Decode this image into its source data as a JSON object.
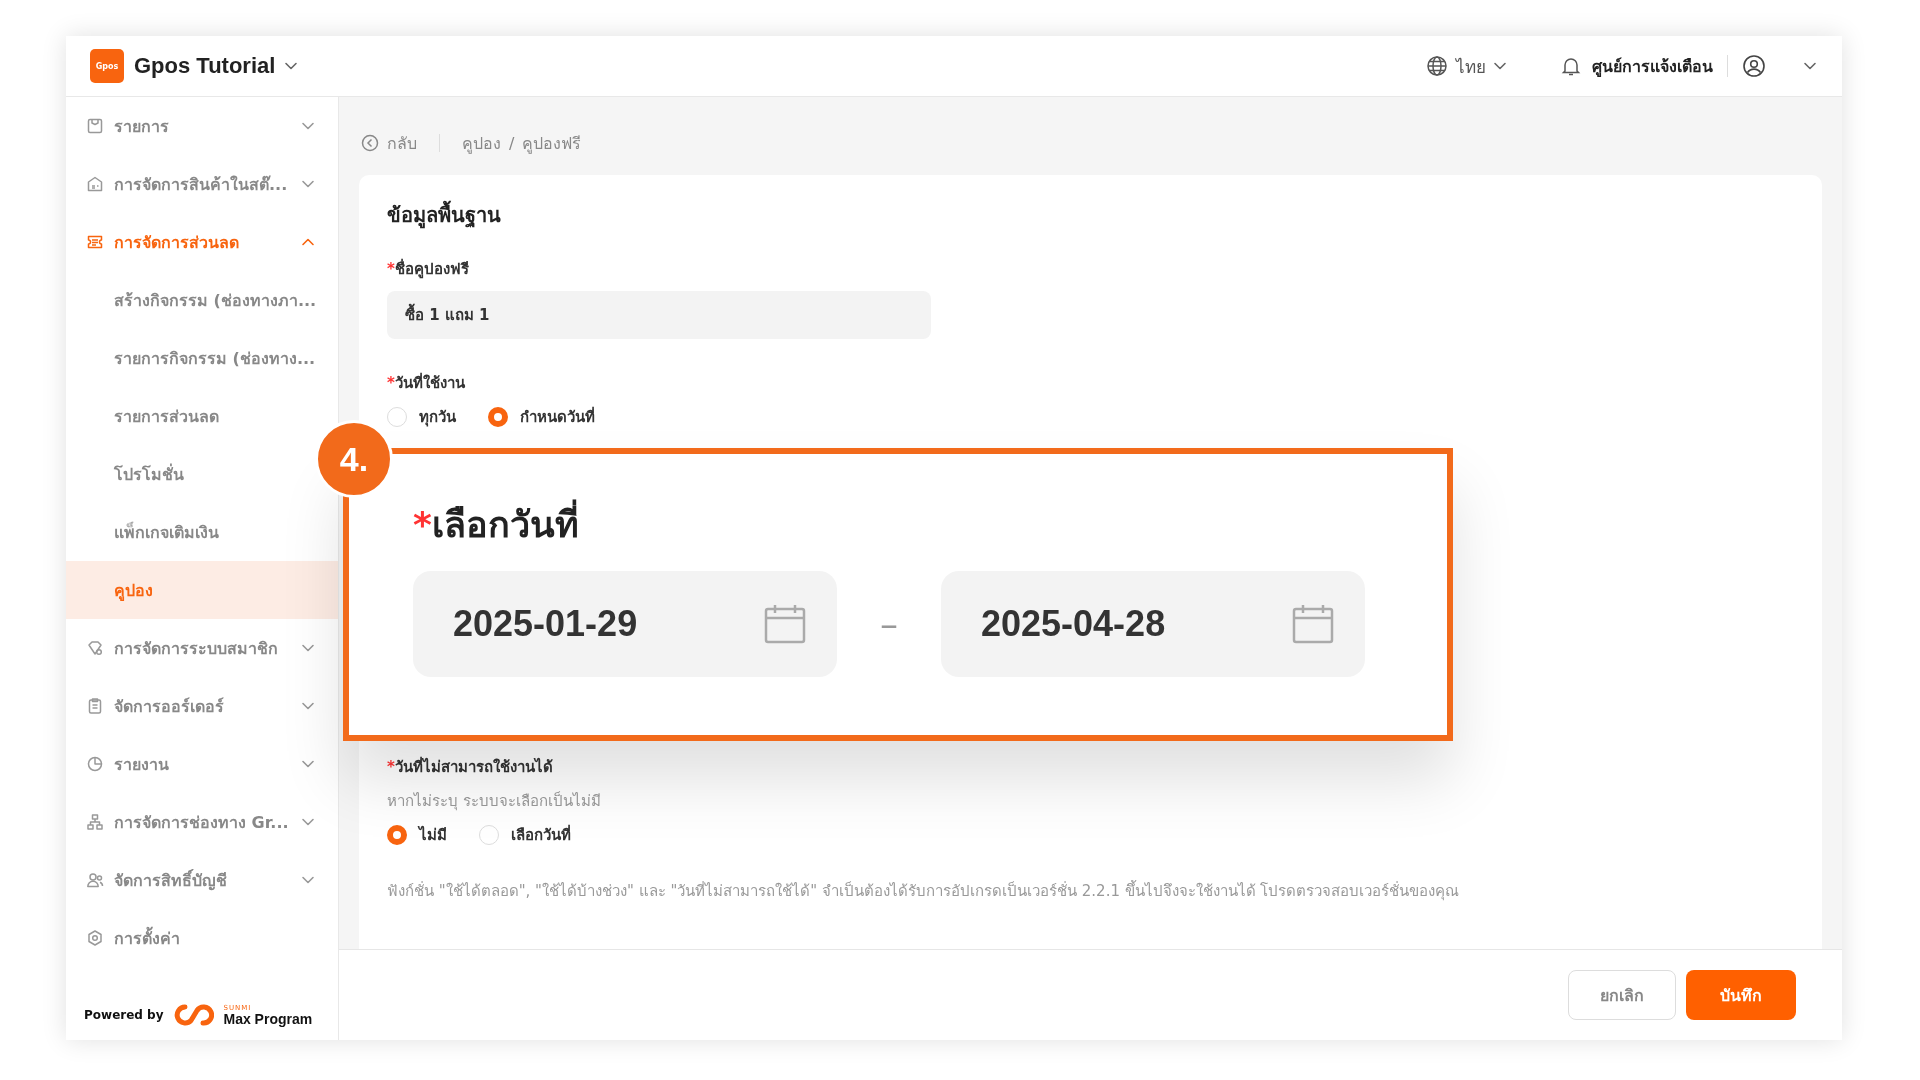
{
  "header": {
    "logo_text": "Gpos",
    "title": "Gpos Tutorial",
    "language": "ไทย",
    "notifications": "ศูนย์การแจ้งเตือน"
  },
  "sidebar": {
    "items": [
      {
        "label": "รายการ",
        "expanded": false
      },
      {
        "label": "การจัดการสินค้าในสต๊...",
        "expanded": false
      },
      {
        "label": "การจัดการส่วนลด",
        "expanded": true,
        "children": [
          {
            "label": "สร้างกิจกรรม (ช่องทางภา...",
            "selected": false
          },
          {
            "label": "รายการกิจกรรม (ช่องทาง...",
            "selected": false
          },
          {
            "label": "รายการส่วนลด",
            "selected": false
          },
          {
            "label": "โปรโมชั่น",
            "selected": false
          },
          {
            "label": "แพ็กเกจเติมเงิน",
            "selected": false
          },
          {
            "label": "คูปอง",
            "selected": true
          }
        ]
      },
      {
        "label": "การจัดการระบบสมาชิก",
        "expanded": false
      },
      {
        "label": "จัดการออร์เดอร์",
        "expanded": false
      },
      {
        "label": "รายงาน",
        "expanded": false
      },
      {
        "label": "การจัดการช่องทาง Gr...",
        "expanded": false
      },
      {
        "label": "จัดการสิทธิ์บัญชี",
        "expanded": false
      },
      {
        "label": "การตั้งค่า"
      }
    ],
    "footer": {
      "powered_by": "Powered by",
      "brand_small": "SUNMI",
      "brand": "Max Program"
    }
  },
  "breadcrumb": {
    "back": "กลับ",
    "separator": "/",
    "path": [
      "คูปอง",
      "คูปองฟรี"
    ]
  },
  "form": {
    "section_title": "ข้อมูลพื้นฐาน",
    "coupon_name": {
      "label": "ชื่อคูปองฟรี",
      "required_mark": "*",
      "value": "ซื้อ 1 แถม 1"
    },
    "usage_date": {
      "label": "วันที่ใช้งาน",
      "required_mark": "*",
      "options": [
        {
          "label": "ทุกวัน",
          "selected": false
        },
        {
          "label": "กำหนดวันที่",
          "selected": true
        }
      ]
    },
    "unavailable_date": {
      "label": "วันที่ไม่สามารถใช้งานได้",
      "required_mark": "*",
      "hint": "หากไม่ระบุ ระบบจะเลือกเป็นไม่มี",
      "options": [
        {
          "label": "ไม่มี",
          "selected": true
        },
        {
          "label": "เลือกวันที่",
          "selected": false
        }
      ]
    },
    "note": "ฟังก์ชั่น \"ใช้ได้ตลอด\", \"ใช้ได้บ้างช่วง\" และ \"วันที่ไม่สามารถใช้ได้\" จำเป็นต้องได้รับการอัปเกรดเป็นเวอร์ชั่น 2.2.1 ขึ้นไปจึงจะใช้งานได้ โปรดตรวจสอบเวอร์ชั่นของคุณ"
  },
  "callout": {
    "badge": "4.",
    "label": "เลือกวันที่",
    "required_mark": "*",
    "separator": "–",
    "start_date": "2025-01-29",
    "end_date": "2025-04-28"
  },
  "buttons": {
    "cancel": "ยกเลิก",
    "save": "บันทึก"
  }
}
